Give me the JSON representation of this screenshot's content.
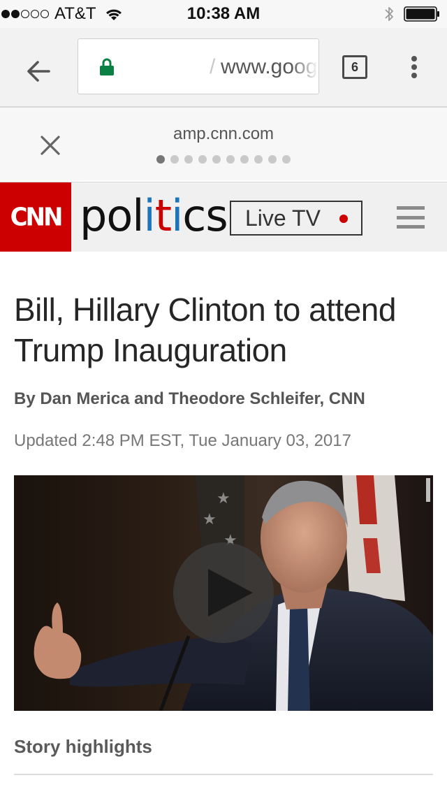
{
  "status_bar": {
    "carrier": "AT&T",
    "time": "10:38 AM",
    "signal_bars": 2,
    "signal_total": 5,
    "battery_level": 1.0
  },
  "browser": {
    "url_prefix": "/",
    "url_text": "www.google.com",
    "tab_count": "6"
  },
  "amp_header": {
    "domain": "amp.cnn.com",
    "page_dots": 10,
    "active_dot": 1
  },
  "cnn_header": {
    "logo_text": "CNN",
    "section": {
      "p1": "pol",
      "i1": "i",
      "t": "t",
      "i2": "i",
      "p2": "cs"
    },
    "live_tv_label": "Live TV",
    "colors": {
      "cnn_red": "#cc0000",
      "politics_blue": "#1b75bc"
    }
  },
  "article": {
    "headline": "Bill, Hillary Clinton to attend Trump Inauguration",
    "byline": "By Dan Merica and Theodore Schleifer, CNN",
    "timestamp": "Updated 2:48 PM EST, Tue January 03, 2017",
    "story_highlights_label": "Story highlights"
  },
  "icons": {
    "signal": "cellular-signal-icon",
    "wifi": "wifi-icon",
    "bluetooth": "bluetooth-icon",
    "battery": "battery-icon",
    "back": "back-arrow-icon",
    "lock": "lock-icon",
    "menu": "more-vert-icon",
    "close": "close-icon",
    "hamburger": "hamburger-menu-icon",
    "play": "play-icon"
  }
}
